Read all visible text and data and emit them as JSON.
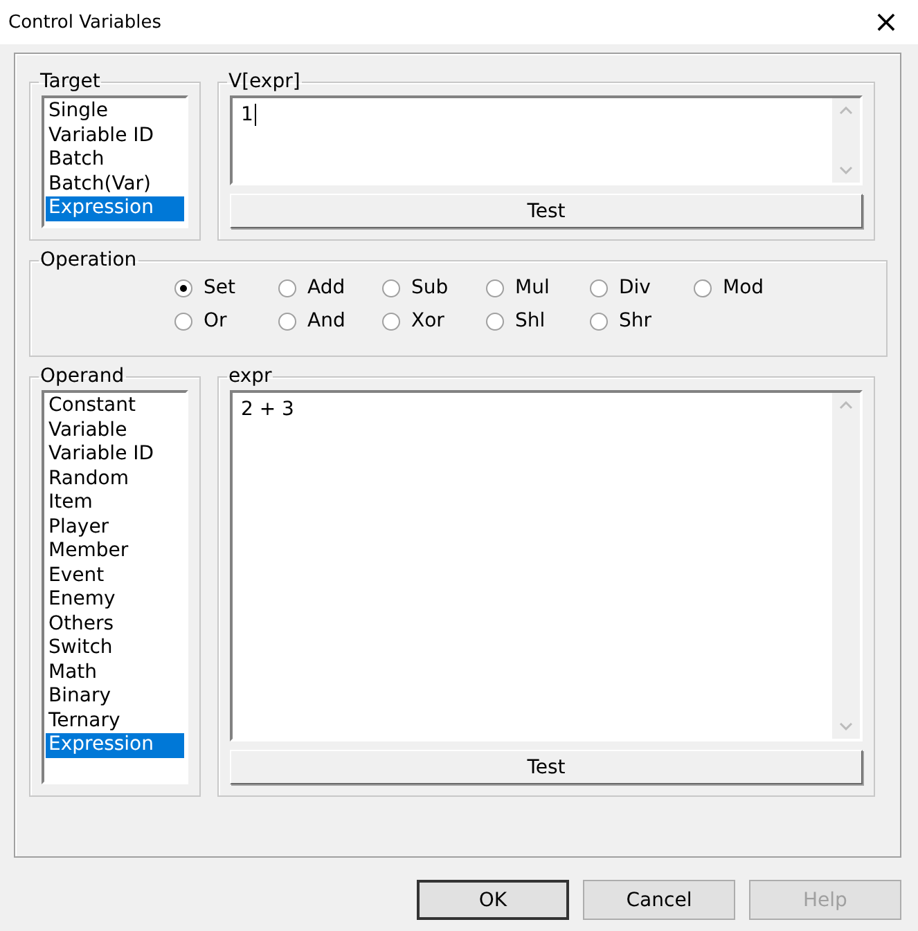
{
  "window": {
    "title": "Control Variables",
    "close": "×"
  },
  "target": {
    "legend": "Target",
    "items": [
      {
        "label": "Single",
        "selected": false
      },
      {
        "label": "Variable ID",
        "selected": false
      },
      {
        "label": "Batch",
        "selected": false
      },
      {
        "label": "Batch(Var)",
        "selected": false
      },
      {
        "label": "Expression",
        "selected": true
      }
    ]
  },
  "v_expr": {
    "legend": "V[expr]",
    "value": "1",
    "button": "Test"
  },
  "operation": {
    "legend": "Operation",
    "rows": [
      [
        {
          "label": "Set",
          "selected": true
        },
        {
          "label": "Add",
          "selected": false
        },
        {
          "label": "Sub",
          "selected": false
        },
        {
          "label": "Mul",
          "selected": false
        },
        {
          "label": "Div",
          "selected": false
        },
        {
          "label": "Mod",
          "selected": false
        }
      ],
      [
        {
          "label": "Or",
          "selected": false
        },
        {
          "label": "And",
          "selected": false
        },
        {
          "label": "Xor",
          "selected": false
        },
        {
          "label": "Shl",
          "selected": false
        },
        {
          "label": "Shr",
          "selected": false
        }
      ]
    ]
  },
  "operand": {
    "legend": "Operand",
    "items": [
      {
        "label": "Constant",
        "selected": false
      },
      {
        "label": "Variable",
        "selected": false
      },
      {
        "label": "Variable ID",
        "selected": false
      },
      {
        "label": "Random",
        "selected": false
      },
      {
        "label": "Item",
        "selected": false
      },
      {
        "label": "Player",
        "selected": false
      },
      {
        "label": "Member",
        "selected": false
      },
      {
        "label": "Event",
        "selected": false
      },
      {
        "label": "Enemy",
        "selected": false
      },
      {
        "label": "Others",
        "selected": false
      },
      {
        "label": "Switch",
        "selected": false
      },
      {
        "label": "Math",
        "selected": false
      },
      {
        "label": "Binary",
        "selected": false
      },
      {
        "label": "Ternary",
        "selected": false
      },
      {
        "label": "Expression",
        "selected": true
      }
    ]
  },
  "expr": {
    "legend": "expr",
    "value": "2 + 3",
    "button": "Test"
  },
  "buttons": [
    {
      "label": "OK",
      "disabled": false,
      "default": true
    },
    {
      "label": "Cancel",
      "disabled": false,
      "default": false
    },
    {
      "label": "Help",
      "disabled": true,
      "default": false
    }
  ]
}
